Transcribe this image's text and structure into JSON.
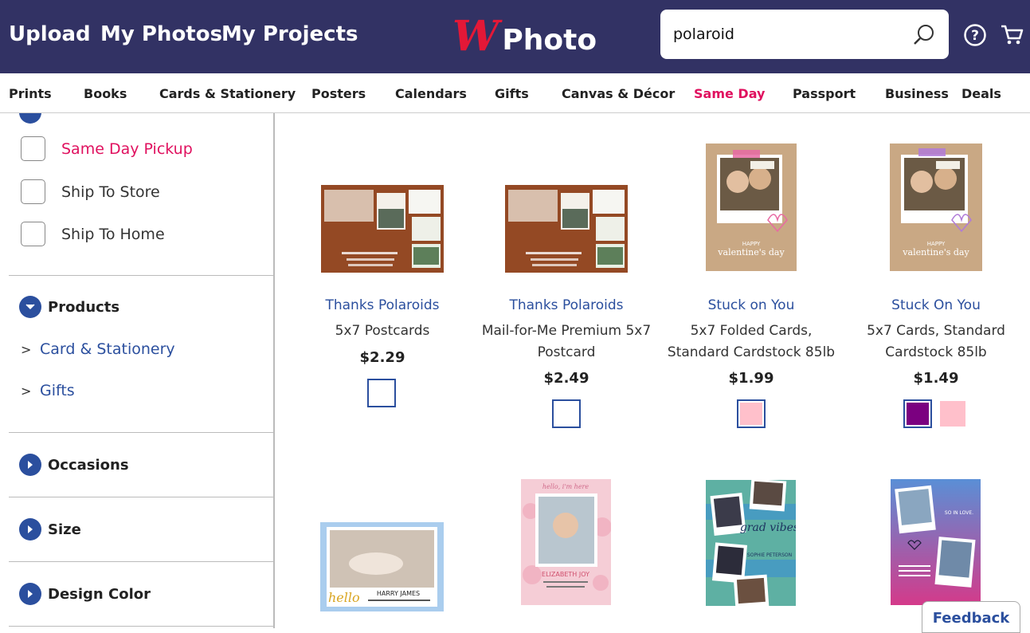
{
  "header": {
    "nav": [
      "Upload",
      "My Photos",
      "My Projects"
    ],
    "logo_text": "Photo",
    "search": {
      "value": "polaroid",
      "icon": "search-icon"
    },
    "icons": [
      "help-icon",
      "cart-icon"
    ]
  },
  "categories": [
    "Prints",
    "Books",
    "Cards & Stationery",
    "Posters",
    "Calendars",
    "Gifts",
    "Canvas & Décor",
    "Same Day",
    "Passport",
    "Business",
    "Deals"
  ],
  "active_category": "Same Day",
  "sidebar": {
    "options": [
      "Same Day Pickup",
      "Ship To Store",
      "Ship To Home"
    ],
    "products_title": "Products",
    "products_links": [
      "Card & Stationery",
      "Gifts"
    ],
    "sections": [
      "Occasions",
      "Size",
      "Design Color"
    ]
  },
  "products": [
    {
      "title": "Thanks Polaroids",
      "subtitle": "5x7 Postcards",
      "price": "$2.29",
      "swatches": [
        "#ffffff"
      ]
    },
    {
      "title": "Thanks Polaroids",
      "subtitle": "Mail-for-Me Premium 5x7 Postcard",
      "price": "$2.49",
      "swatches": [
        "#ffffff"
      ]
    },
    {
      "title": "Stuck on You",
      "subtitle": "5x7 Folded Cards, Standard Cardstock 85lb",
      "price": "$1.99",
      "swatches": [
        "#ffc0cb"
      ]
    },
    {
      "title": "Stuck On You",
      "subtitle": "5x7 Cards, Standard Cardstock 85lb",
      "price": "$1.49",
      "swatches": [
        "#7b0080",
        "#ffc0cb"
      ]
    }
  ],
  "thumb_text": {
    "valentine_small": "HAPPY",
    "valentine_big": "valentine's day",
    "harry": "HARRY JAMES",
    "hello_script": "hello",
    "elizabeth": "ELIZABETH JOY",
    "hello_baby": "hello, i'm here",
    "grad": "grad vibes",
    "sophie": "SOPHIE PETERSON",
    "so_in_love": "SO IN LOVE."
  },
  "feedback": "Feedback",
  "colors": {
    "header_bg": "#323264",
    "accent": "#e0115f",
    "link": "#2b4f9e",
    "brand_red": "#e31837"
  }
}
